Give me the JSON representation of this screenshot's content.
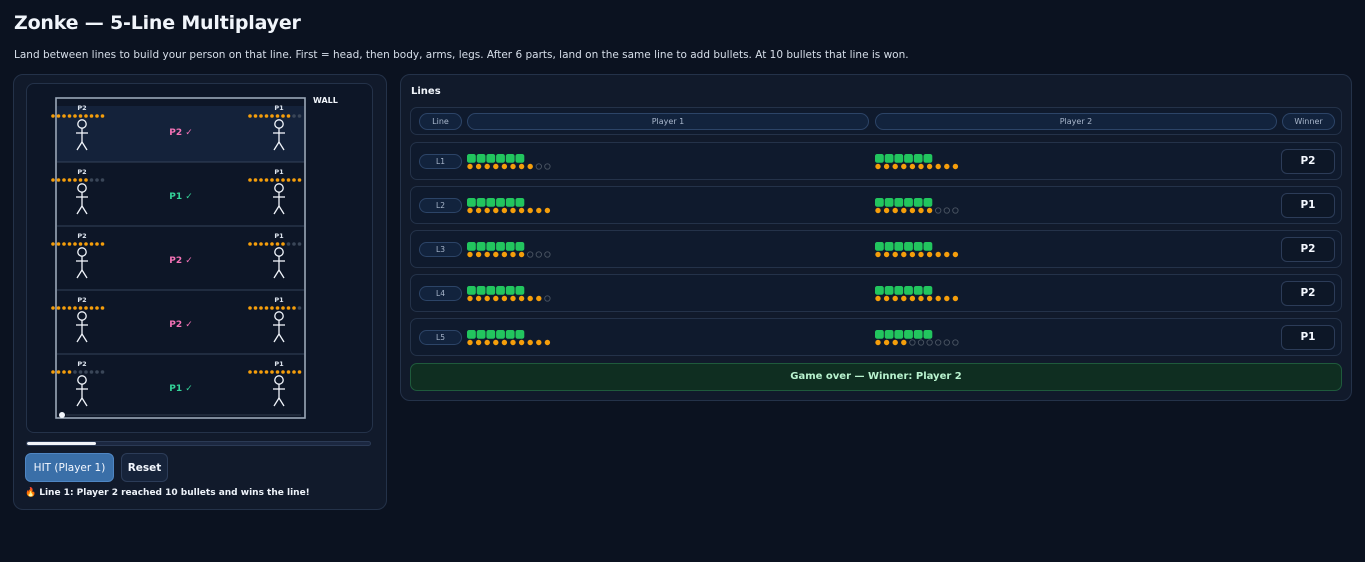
{
  "header": {
    "title": "Zonke — 5-Line Multiplayer",
    "subtitle": "Land between lines to build your person on that line. First = head, then body, arms, legs. After 6 parts, land on the same line to add bullets. At 10 bullets that line is won."
  },
  "board": {
    "wall_label": "WALL",
    "p1_label": "P1",
    "p2_label": "P2",
    "max_bullets": 10,
    "ball_progress": 0.2,
    "colors": {
      "p1": "#34d399",
      "p2": "#f472b6",
      "bullet": "#f59e0b",
      "empty": "#3a4658"
    },
    "lines": [
      {
        "winner_label": "P2 ✓",
        "winner": "p2",
        "p1_bullets": 8,
        "p2_bullets": 10
      },
      {
        "winner_label": "P1 ✓",
        "winner": "p1",
        "p1_bullets": 10,
        "p2_bullets": 7
      },
      {
        "winner_label": "P2 ✓",
        "winner": "p2",
        "p1_bullets": 7,
        "p2_bullets": 10
      },
      {
        "winner_label": "P2 ✓",
        "winner": "p2",
        "p1_bullets": 9,
        "p2_bullets": 10
      },
      {
        "winner_label": "P1 ✓",
        "winner": "p1",
        "p1_bullets": 10,
        "p2_bullets": 4
      }
    ]
  },
  "controls": {
    "hit_label": "HIT (Player 1)",
    "reset_label": "Reset"
  },
  "status": {
    "icon": "fire-icon",
    "message": "Line 1: Player 2 reached 10 bullets and wins the line!"
  },
  "table": {
    "heading": "Lines",
    "columns": [
      "Line",
      "Player 1",
      "Player 2",
      "Winner"
    ],
    "parts_total": 6,
    "rows": [
      {
        "line": "L1",
        "p1_parts": 6,
        "p1_bullets": 8,
        "p2_parts": 6,
        "p2_bullets": 10,
        "winner": "P2"
      },
      {
        "line": "L2",
        "p1_parts": 6,
        "p1_bullets": 10,
        "p2_parts": 6,
        "p2_bullets": 7,
        "winner": "P1"
      },
      {
        "line": "L3",
        "p1_parts": 6,
        "p1_bullets": 7,
        "p2_parts": 6,
        "p2_bullets": 10,
        "winner": "P2"
      },
      {
        "line": "L4",
        "p1_parts": 6,
        "p1_bullets": 9,
        "p2_parts": 6,
        "p2_bullets": 10,
        "winner": "P2"
      },
      {
        "line": "L5",
        "p1_parts": 6,
        "p1_bullets": 10,
        "p2_parts": 6,
        "p2_bullets": 4,
        "winner": "P1"
      }
    ],
    "colors": {
      "part": "#22c55e",
      "bullet": "#f59e0b",
      "empty_stroke": "#4b5563"
    }
  },
  "game_over": "Game over — Winner: Player 2"
}
